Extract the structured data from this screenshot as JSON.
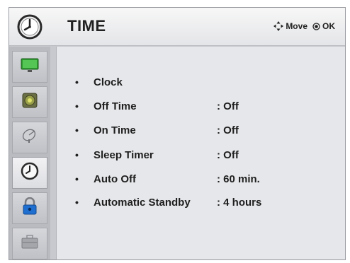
{
  "header": {
    "title": "TIME",
    "hint_move": "Move",
    "hint_ok": "OK",
    "icon": "clock-icon"
  },
  "sidebar": {
    "items": [
      {
        "icon": "picture-icon",
        "active": false
      },
      {
        "icon": "audio-icon",
        "active": false
      },
      {
        "icon": "satellite-dish-icon",
        "active": false
      },
      {
        "icon": "clock-icon",
        "active": true
      },
      {
        "icon": "lock-icon",
        "active": false
      },
      {
        "icon": "toolbox-icon",
        "active": false
      }
    ]
  },
  "menu": {
    "bullet": "•",
    "items": [
      {
        "label": "Clock",
        "value": ""
      },
      {
        "label": "Off Time",
        "value": ": Off"
      },
      {
        "label": "On Time",
        "value": ": Off"
      },
      {
        "label": "Sleep Timer",
        "value": ": Off"
      },
      {
        "label": "Auto Off",
        "value": ": 60 min."
      },
      {
        "label": "Automatic Standby",
        "value": ": 4 hours"
      }
    ]
  }
}
